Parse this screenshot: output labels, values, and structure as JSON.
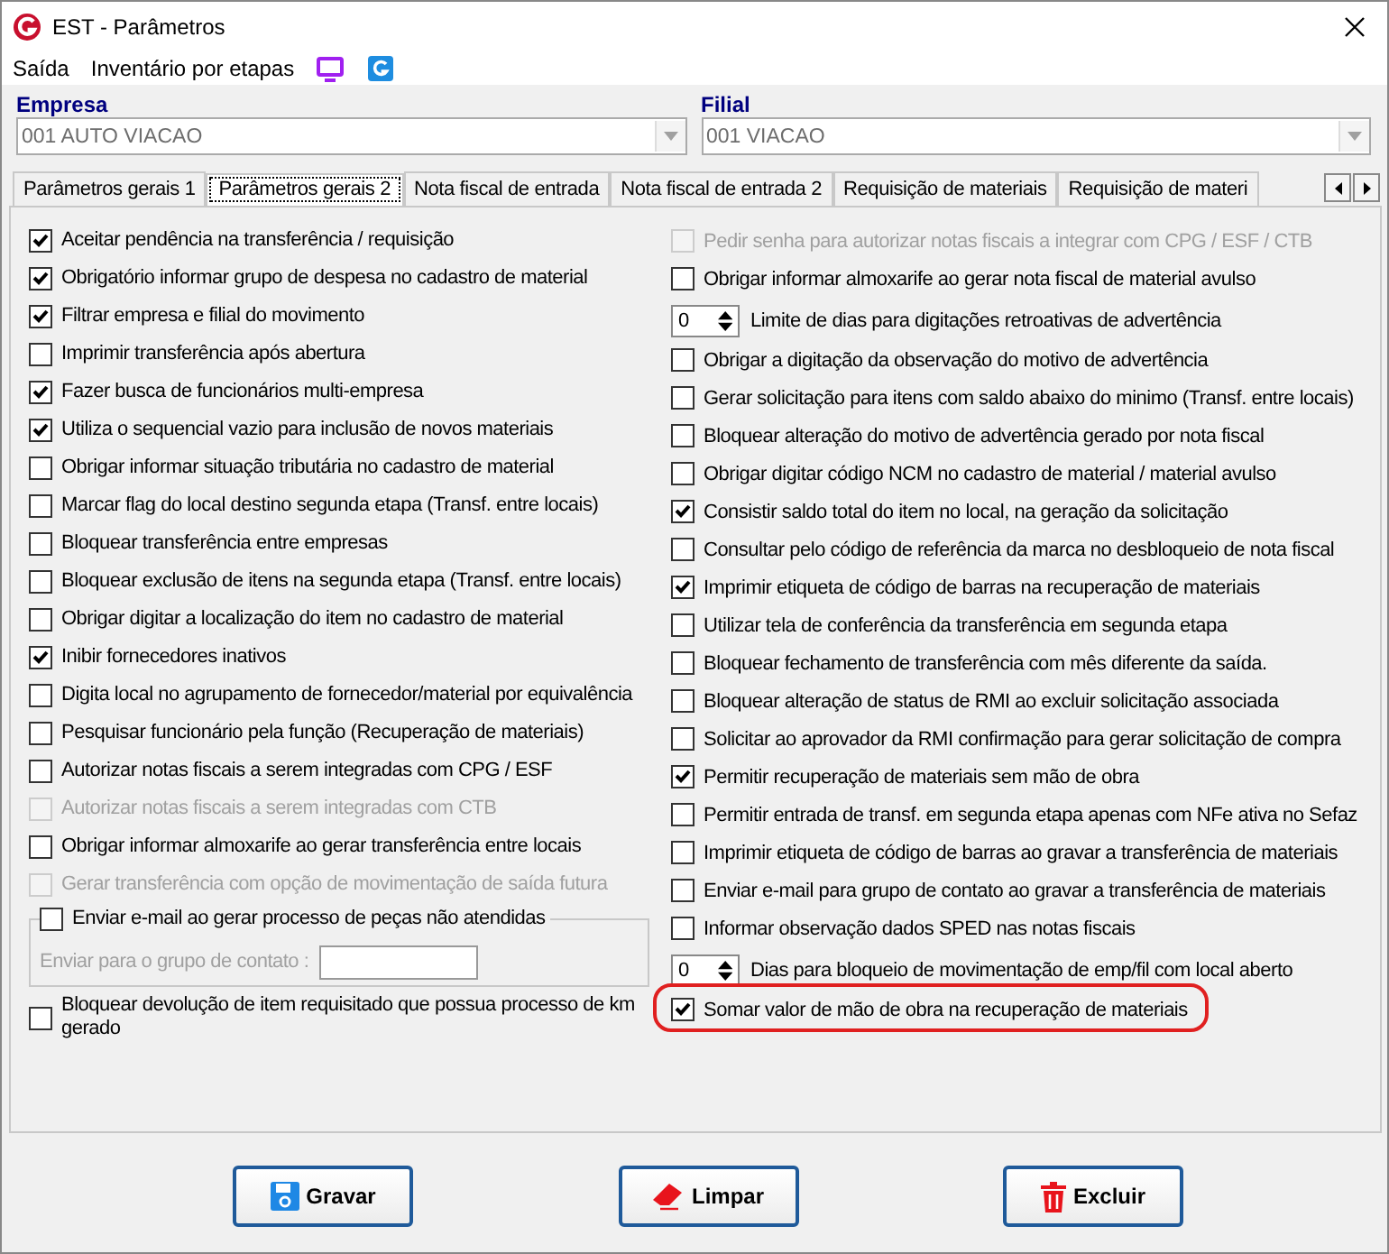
{
  "window": {
    "title": "EST - Parâmetros"
  },
  "menu": [
    "Saída",
    "Inventário por etapas"
  ],
  "empresa": {
    "label": "Empresa",
    "value": "001 AUTO VIACAO"
  },
  "filial": {
    "label": "Filial",
    "value": "001 VIACAO"
  },
  "tabs": [
    {
      "label": "Parâmetros gerais 1",
      "selected": false
    },
    {
      "label": "Parâmetros gerais 2",
      "selected": true
    },
    {
      "label": "Nota fiscal de entrada",
      "selected": false
    },
    {
      "label": "Nota fiscal de entrada 2",
      "selected": false
    },
    {
      "label": "Requisição de materiais",
      "selected": false
    },
    {
      "label": "Requisição de materi",
      "selected": false
    }
  ],
  "left_options": [
    {
      "kind": "checkbox",
      "label": "Aceitar pendência na transferência / requisição",
      "checked": true,
      "disabled": false
    },
    {
      "kind": "checkbox",
      "label": "Obrigatório informar grupo de despesa no cadastro de material",
      "checked": true,
      "disabled": false
    },
    {
      "kind": "checkbox",
      "label": "Filtrar empresa e filial do movimento",
      "checked": true,
      "disabled": false
    },
    {
      "kind": "checkbox",
      "label": "Imprimir transferência após abertura",
      "checked": false,
      "disabled": false
    },
    {
      "kind": "checkbox",
      "label": "Fazer busca de funcionários multi-empresa",
      "checked": true,
      "disabled": false
    },
    {
      "kind": "checkbox",
      "label": "Utiliza o sequencial vazio para inclusão de novos materiais",
      "checked": true,
      "disabled": false
    },
    {
      "kind": "checkbox",
      "label": "Obrigar informar situação tributária no cadastro de material",
      "checked": false,
      "disabled": false
    },
    {
      "kind": "checkbox",
      "label": "Marcar flag do local destino segunda etapa (Transf. entre locais)",
      "checked": false,
      "disabled": false
    },
    {
      "kind": "checkbox",
      "label": "Bloquear transferência entre empresas",
      "checked": false,
      "disabled": false
    },
    {
      "kind": "checkbox",
      "label": "Bloquear exclusão de itens na segunda etapa (Transf. entre locais)",
      "checked": false,
      "disabled": false
    },
    {
      "kind": "checkbox",
      "label": "Obrigar digitar a localização do item no cadastro de material",
      "checked": false,
      "disabled": false
    },
    {
      "kind": "checkbox",
      "label": "Inibir fornecedores inativos",
      "checked": true,
      "disabled": false
    },
    {
      "kind": "checkbox",
      "label": "Digita local no agrupamento de fornecedor/material por equivalência",
      "checked": false,
      "disabled": false
    },
    {
      "kind": "checkbox",
      "label": "Pesquisar funcionário pela função (Recuperação de materiais)",
      "checked": false,
      "disabled": false
    },
    {
      "kind": "checkbox",
      "label": "Autorizar notas fiscais a serem integradas com CPG / ESF",
      "checked": false,
      "disabled": false
    },
    {
      "kind": "checkbox",
      "label": "Autorizar notas fiscais a serem integradas com CTB",
      "checked": false,
      "disabled": true
    },
    {
      "kind": "checkbox",
      "label": "Obrigar informar almoxarife ao gerar transferência entre locais",
      "checked": false,
      "disabled": false
    },
    {
      "kind": "checkbox",
      "label": "Gerar transferência com opção de movimentação de saída futura",
      "checked": false,
      "disabled": true
    },
    {
      "kind": "group",
      "label": "Enviar e-mail ao gerar processo de peças não atendidas",
      "checked": false,
      "field_label": "Enviar para o grupo de contato :"
    },
    {
      "kind": "checkbox",
      "label": "Bloquear devolução de item requisitado que possua processo de km gerado",
      "checked": false,
      "disabled": false
    }
  ],
  "right_options": [
    {
      "kind": "checkbox",
      "label": "Pedir senha para autorizar notas fiscais a integrar com CPG / ESF / CTB",
      "checked": false,
      "disabled": true,
      "highlighted": false
    },
    {
      "kind": "checkbox",
      "label": "Obrigar informar almoxarife ao gerar nota fiscal de material avulso",
      "checked": false,
      "disabled": false,
      "highlighted": false
    },
    {
      "kind": "spinner",
      "value": "0",
      "caption": "Limite de dias para digitações retroativas de advertência"
    },
    {
      "kind": "checkbox",
      "label": "Obrigar a digitação da observação do motivo de advertência",
      "checked": false,
      "disabled": false,
      "highlighted": false
    },
    {
      "kind": "checkbox",
      "label": "Gerar solicitação para itens com saldo abaixo do minimo (Transf. entre locais)",
      "checked": false,
      "disabled": false,
      "highlighted": false
    },
    {
      "kind": "checkbox",
      "label": "Bloquear alteração do motivo de advertência gerado por nota fiscal",
      "checked": false,
      "disabled": false,
      "highlighted": false
    },
    {
      "kind": "checkbox",
      "label": "Obrigar digitar código NCM no cadastro de material / material avulso",
      "checked": false,
      "disabled": false,
      "highlighted": false
    },
    {
      "kind": "checkbox",
      "label": "Consistir saldo total do item no local, na geração da solicitação",
      "checked": true,
      "disabled": false,
      "highlighted": false
    },
    {
      "kind": "checkbox",
      "label": "Consultar pelo código de referência da marca no desbloqueio de nota fiscal",
      "checked": false,
      "disabled": false,
      "highlighted": false
    },
    {
      "kind": "checkbox",
      "label": "Imprimir etiqueta de código de barras na recuperação de materiais",
      "checked": true,
      "disabled": false,
      "highlighted": false
    },
    {
      "kind": "checkbox",
      "label": "Utilizar tela de conferência da transferência em segunda etapa",
      "checked": false,
      "disabled": false,
      "highlighted": false
    },
    {
      "kind": "checkbox",
      "label": "Bloquear fechamento de transferência com mês diferente da saída.",
      "checked": false,
      "disabled": false,
      "highlighted": false
    },
    {
      "kind": "checkbox",
      "label": "Bloquear alteração de status de RMI ao excluir solicitação associada",
      "checked": false,
      "disabled": false,
      "highlighted": false
    },
    {
      "kind": "checkbox",
      "label": "Solicitar ao aprovador da RMI confirmação para gerar solicitação de compra",
      "checked": false,
      "disabled": false,
      "highlighted": false
    },
    {
      "kind": "checkbox",
      "label": "Permitir recuperação de materiais sem mão de obra",
      "checked": true,
      "disabled": false,
      "highlighted": false
    },
    {
      "kind": "checkbox",
      "label": "Permitir entrada de transf. em segunda etapa apenas com NFe ativa no Sefaz",
      "checked": false,
      "disabled": false,
      "highlighted": false
    },
    {
      "kind": "checkbox",
      "label": "Imprimir etiqueta de código de barras ao gravar a transferência de materiais",
      "checked": false,
      "disabled": false,
      "highlighted": false
    },
    {
      "kind": "checkbox",
      "label": "Enviar e-mail para grupo de contato ao gravar a transferência de materiais",
      "checked": false,
      "disabled": false,
      "highlighted": false
    },
    {
      "kind": "checkbox",
      "label": "Informar observação dados SPED nas notas fiscais",
      "checked": false,
      "disabled": false,
      "highlighted": false
    },
    {
      "kind": "spinner",
      "value": "0",
      "caption": "Dias para bloqueio de movimentação de emp/fil com local aberto"
    },
    {
      "kind": "checkbox",
      "label": "Somar valor de mão de obra na recuperação de materiais",
      "checked": true,
      "disabled": false,
      "highlighted": true
    }
  ],
  "buttons": [
    {
      "kind": "save",
      "label": "Gravar"
    },
    {
      "kind": "clear",
      "label": "Limpar"
    },
    {
      "kind": "delete",
      "label": "Excluir"
    }
  ]
}
